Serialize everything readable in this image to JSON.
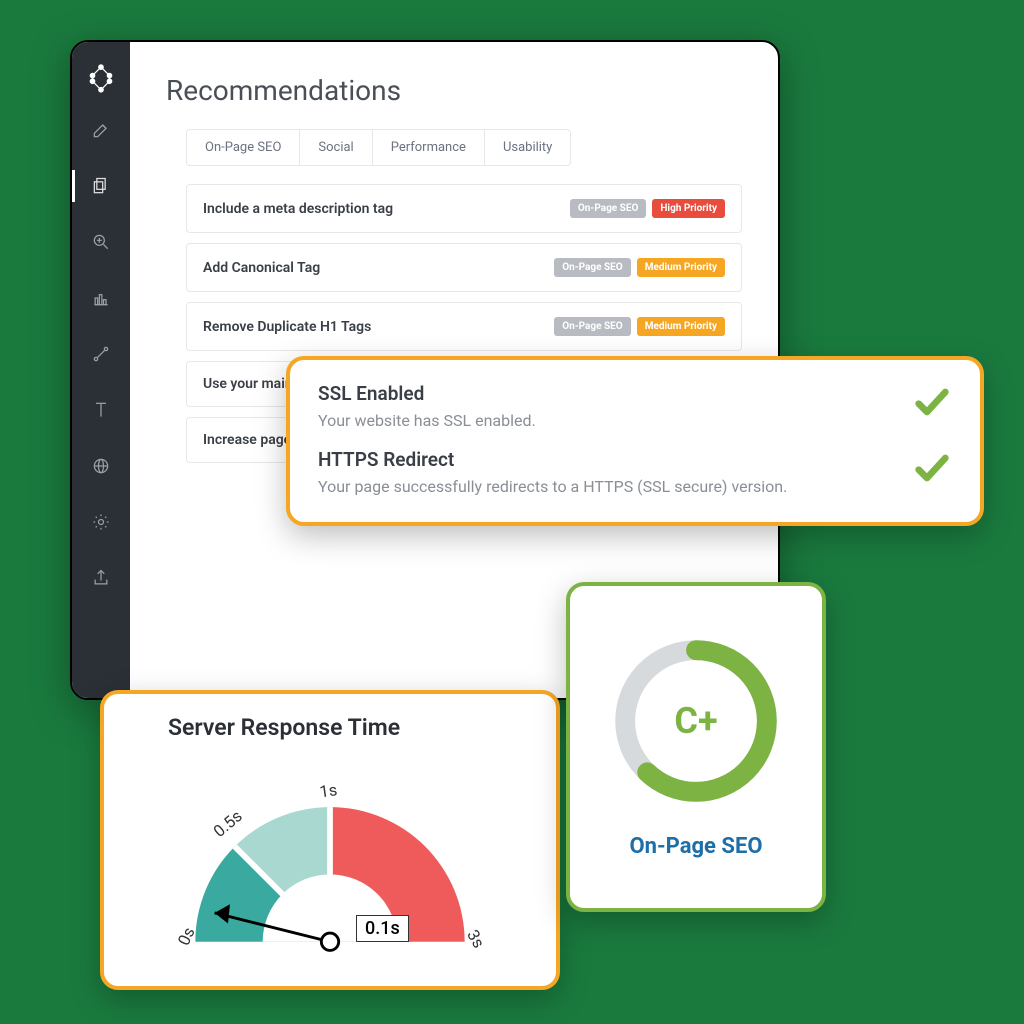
{
  "page": {
    "title": "Recommendations"
  },
  "tabs": [
    {
      "label": "On-Page SEO"
    },
    {
      "label": "Social"
    },
    {
      "label": "Performance"
    },
    {
      "label": "Usability"
    }
  ],
  "recommendations": [
    {
      "title": "Include a meta description tag",
      "category": "On-Page SEO",
      "priority": "High Priority",
      "priority_level": "high"
    },
    {
      "title": "Add Canonical Tag",
      "category": "On-Page SEO",
      "priority": "Medium Priority",
      "priority_level": "med"
    },
    {
      "title": "Remove Duplicate H1 Tags",
      "category": "On-Page SEO",
      "priority": "Medium Priority",
      "priority_level": "med"
    },
    {
      "title": "Use your main keywords across the important HTML tags",
      "category": "",
      "priority": "",
      "priority_level": ""
    },
    {
      "title": "Increase page text content",
      "category": "",
      "priority": "",
      "priority_level": ""
    }
  ],
  "ssl": {
    "items": [
      {
        "title": "SSL Enabled",
        "desc": "Your website has SSL enabled.",
        "pass": true
      },
      {
        "title": "HTTPS Redirect",
        "desc": "Your page successfully redirects to a HTTPS (SSL secure) version.",
        "pass": true
      }
    ]
  },
  "gauge": {
    "title": "Server Response Time",
    "value_label": "0.1s",
    "ticks": [
      "0s",
      "0.5s",
      "1s",
      "3s"
    ]
  },
  "grade": {
    "letter": "C+",
    "label": "On-Page SEO",
    "percent": 62
  },
  "sidebar": {
    "icons": [
      "edit",
      "pages",
      "search",
      "chart",
      "link",
      "tool",
      "globe",
      "gear",
      "share"
    ]
  },
  "chart_data": [
    {
      "type": "gauge",
      "title": "Server Response Time",
      "value": 0.1,
      "unit": "s",
      "ticks": [
        0,
        0.5,
        1,
        3
      ],
      "segments": [
        {
          "from": 0,
          "to": 0.5,
          "color": "#3aa99f"
        },
        {
          "from": 0.5,
          "to": 1,
          "color": "#a8d8d0"
        },
        {
          "from": 1,
          "to": 3,
          "color": "#ef5b5b"
        }
      ]
    },
    {
      "type": "donut_progress",
      "title": "On-Page SEO",
      "grade": "C+",
      "percent": 62,
      "color": "#7cb342",
      "track_color": "#d7dadd"
    }
  ]
}
